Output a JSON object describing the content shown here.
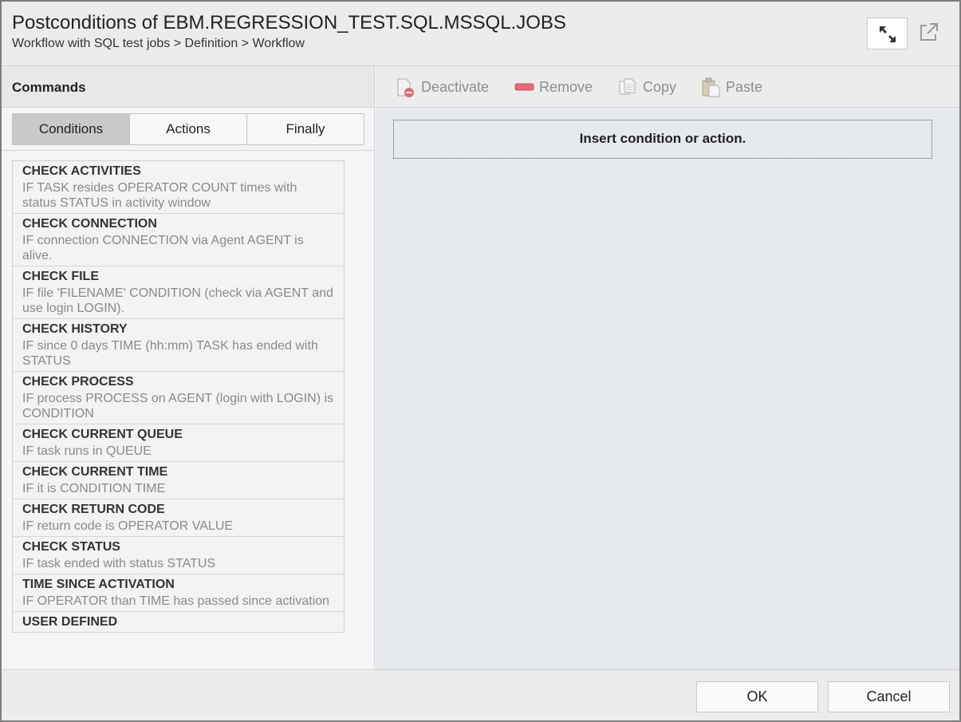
{
  "dialog": {
    "title": "Postconditions of EBM.REGRESSION_TEST.SQL.MSSQL.JOBS",
    "breadcrumb": "Workflow with SQL test jobs > Definition > Workflow"
  },
  "left": {
    "heading": "Commands",
    "tabs": [
      {
        "label": "Conditions",
        "active": true
      },
      {
        "label": "Actions",
        "active": false
      },
      {
        "label": "Finally",
        "active": false
      }
    ],
    "commands": [
      {
        "name": "CHECK ACTIVITIES",
        "desc": "IF TASK resides OPERATOR COUNT times with status STATUS in activity window"
      },
      {
        "name": "CHECK CONNECTION",
        "desc": "IF connection CONNECTION via Agent AGENT is alive."
      },
      {
        "name": "CHECK FILE",
        "desc": "IF file 'FILENAME' CONDITION (check via AGENT and use login LOGIN)."
      },
      {
        "name": "CHECK HISTORY",
        "desc": "IF since 0 days TIME (hh:mm) TASK has ended with STATUS"
      },
      {
        "name": "CHECK PROCESS",
        "desc": "IF process PROCESS on AGENT (login with LOGIN) is CONDITION"
      },
      {
        "name": "CHECK CURRENT QUEUE",
        "desc": "IF task runs in QUEUE"
      },
      {
        "name": "CHECK CURRENT TIME",
        "desc": "IF it is CONDITION TIME"
      },
      {
        "name": "CHECK RETURN CODE",
        "desc": "IF return code is OPERATOR VALUE"
      },
      {
        "name": "CHECK STATUS",
        "desc": "IF task ended with status STATUS"
      },
      {
        "name": "TIME SINCE ACTIVATION",
        "desc": "IF OPERATOR than TIME has passed since activation"
      },
      {
        "name": "USER DEFINED",
        "desc": ""
      }
    ]
  },
  "toolbar": {
    "deactivate": "Deactivate",
    "remove": "Remove",
    "copy": "Copy",
    "paste": "Paste"
  },
  "main": {
    "placeholder": "Insert condition or action."
  },
  "footer": {
    "ok": "OK",
    "cancel": "Cancel"
  },
  "colors": {
    "active_tab": "#c9c9c9",
    "remove_icon": "#e06c75",
    "disabled_text": "#8e8e8e"
  }
}
